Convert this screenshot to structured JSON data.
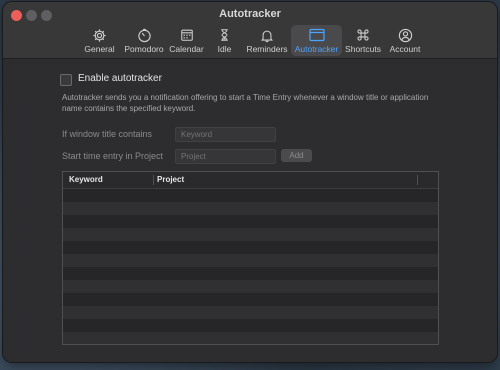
{
  "window": {
    "title": "Autotracker"
  },
  "toolbar": {
    "tabs": [
      {
        "label": "General",
        "icon": "gear-icon"
      },
      {
        "label": "Pomodoro",
        "icon": "timer-icon"
      },
      {
        "label": "Calendar",
        "icon": "calendar-icon"
      },
      {
        "label": "Idle",
        "icon": "hourglass-icon"
      },
      {
        "label": "Reminders",
        "icon": "bell-icon"
      },
      {
        "label": "Autotracker",
        "icon": "window-icon",
        "active": true
      },
      {
        "label": "Shortcuts",
        "icon": "command-icon"
      },
      {
        "label": "Account",
        "icon": "person-icon"
      }
    ],
    "active_color": "#4da3ff"
  },
  "autotracker": {
    "enable_label": "Enable autotracker",
    "enabled": false,
    "description": "Autotracker sends you a notification offering to start a Time Entry whenever a window title or application name contains the specified keyword.",
    "keyword_label": "If window title contains",
    "keyword_placeholder": "Keyword",
    "project_label": "Start time entry in Project",
    "project_placeholder": "Project",
    "add_label": "Add",
    "table": {
      "columns": [
        "Keyword",
        "Project"
      ],
      "rows": []
    }
  }
}
